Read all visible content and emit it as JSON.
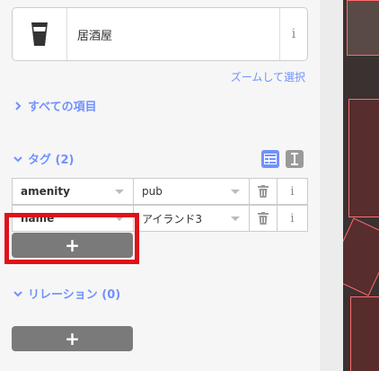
{
  "preset": {
    "label": "居酒屋",
    "icon": "beer-glass-icon",
    "info_glyph": "i"
  },
  "zoom_to_selection": "ズームして選択",
  "all_fields": {
    "label": "すべての項目"
  },
  "tags": {
    "title": "タグ (2)",
    "rows": [
      {
        "key": "amenity",
        "value": "pub"
      },
      {
        "key": "name",
        "value": "アイランド3"
      }
    ],
    "info_glyph": "i",
    "add_label": "+"
  },
  "relations": {
    "title": "リレーション (0)",
    "add_label": "+"
  },
  "colors": {
    "accent": "#7092ff",
    "highlight": "#e0101a",
    "add_button": "#7a7a7a"
  }
}
